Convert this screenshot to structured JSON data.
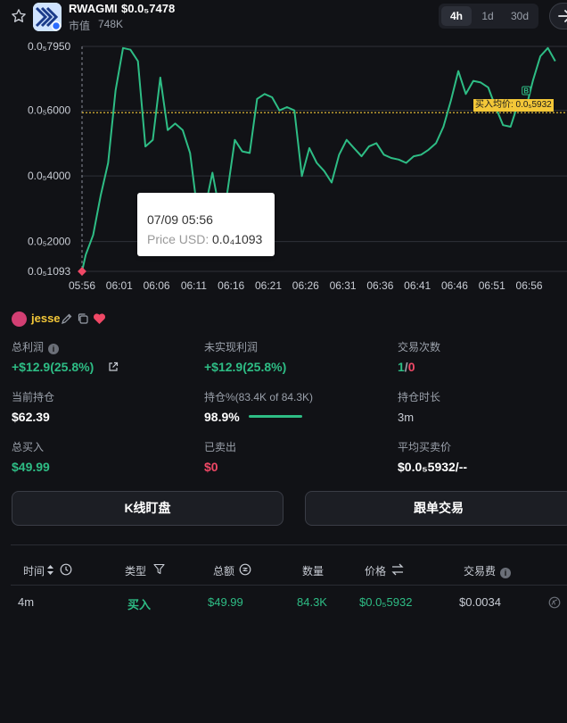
{
  "header": {
    "symbol": "RWAGMI",
    "price": "$0.0₅7478",
    "market_cap_label": "市值",
    "market_cap": "748K",
    "timeframes": [
      "4h",
      "1d",
      "30d"
    ],
    "active_timeframe": "4h",
    "icons": [
      "star-icon",
      "token-logo",
      "arrow-right-icon"
    ]
  },
  "chart_data": {
    "type": "line",
    "x_ticks": [
      "05:56",
      "06:01",
      "06:06",
      "06:11",
      "06:16",
      "06:21",
      "06:26",
      "06:31",
      "06:36",
      "06:41",
      "06:46",
      "06:51",
      "06:56"
    ],
    "y_ticks": [
      "0.0₅7950",
      "0.0₅6000",
      "0.0₅4000",
      "0.0₅2000",
      "0.0₅1093"
    ],
    "y_tick_values": [
      7.95,
      6.0,
      4.0,
      2.0,
      1.093
    ],
    "ylim": [
      1.093,
      7.95
    ],
    "x_start_minute": 0,
    "x_end_minute": 64,
    "series": [
      {
        "color": "#2ebd85",
        "x": [
          0,
          0.5,
          1.5,
          2.5,
          3.5,
          4.5,
          5.5,
          6.5,
          7.5,
          8.5,
          9.5,
          10.5,
          11.5,
          12.5,
          13.5,
          14.5,
          15.5,
          16.5,
          17.5,
          18.5,
          19.5,
          20.5,
          21.5,
          22.5,
          23.5,
          24.5,
          25.5,
          26.5,
          27.5,
          28.5,
          29.5,
          30.5,
          31.5,
          32.5,
          33.5,
          34.5,
          35.5,
          36.5,
          37.5,
          38.5,
          39.5,
          40.5,
          41.5,
          42.5,
          43.5,
          44.5,
          45.5,
          46.5,
          47.5,
          48.5,
          49.5,
          50.5,
          51.5,
          52.5,
          53.5,
          54.5,
          55.5,
          56.5,
          57.5,
          58.5,
          59.5,
          60.5,
          61.5,
          62.5,
          63.5
        ],
        "values": [
          1.093,
          1.6,
          2.2,
          3.4,
          4.4,
          6.6,
          7.9,
          7.85,
          7.5,
          4.9,
          5.1,
          7.0,
          5.4,
          5.6,
          5.4,
          4.7,
          2.9,
          3.0,
          4.1,
          2.9,
          3.5,
          5.1,
          4.75,
          4.7,
          6.35,
          6.5,
          6.4,
          6.0,
          6.1,
          6.0,
          4.0,
          4.85,
          4.4,
          4.15,
          3.8,
          4.65,
          5.1,
          4.85,
          4.6,
          4.9,
          5.0,
          4.65,
          4.55,
          4.5,
          4.4,
          4.6,
          4.65,
          4.8,
          5.0,
          5.5,
          6.3,
          7.2,
          6.5,
          6.9,
          6.85,
          6.7,
          6.1,
          5.55,
          5.5,
          6.2,
          6.0,
          6.9,
          7.65,
          7.9,
          7.5
        ]
      }
    ],
    "reference_line": {
      "value": 5.932,
      "color": "#f3c738",
      "label": "买入均价: 0.0₅5932"
    },
    "markers": [
      {
        "x": 0,
        "value": 1.093,
        "color": "#f04866"
      },
      {
        "x": 59.6,
        "value": 6.4,
        "label": "B",
        "color": "#2ebd85"
      }
    ],
    "crosshair_x": 0,
    "grid": true,
    "tooltip": {
      "date": "07/09 05:56",
      "label": "Price USD:",
      "value": "0.0₄1093"
    }
  },
  "user": {
    "name": "jesse"
  },
  "stats": {
    "total_profit_label": "总利润",
    "total_profit": "+$12.9(25.8%)",
    "unrealized_label": "未实现利润",
    "unrealized": "+$12.9(25.8%)",
    "trades_label": "交易次数",
    "trades_buy": "1",
    "trades_sep": "/",
    "trades_sell": "0",
    "holding_label": "当前持仓",
    "holding": "$62.39",
    "holding_pct_label": "持仓%(83.4K of 84.3K)",
    "holding_pct": "98.9%",
    "holding_pct_value": 0.989,
    "duration_label": "持仓时长",
    "duration": "3m",
    "total_buy_label": "总买入",
    "total_buy": "$49.99",
    "sold_label": "已卖出",
    "sold": "$0",
    "avg_price_label": "平均买卖价",
    "avg_price": "$0.0₅5932/--"
  },
  "buttons": {
    "kline": "K线盯盘",
    "copy_trade": "跟单交易"
  },
  "table": {
    "headers": [
      "时间",
      "类型",
      "总额",
      "数量",
      "价格",
      "交易费"
    ],
    "rows": [
      {
        "time": "4m",
        "type": "买入",
        "total": "$49.99",
        "qty": "84.3K",
        "price": "$0.0₅5932",
        "fee": "$0.0034"
      }
    ]
  },
  "colors": {
    "accent_green": "#2ebd85",
    "accent_red": "#f04866",
    "gold": "#f3c738",
    "bg": "#111216"
  }
}
